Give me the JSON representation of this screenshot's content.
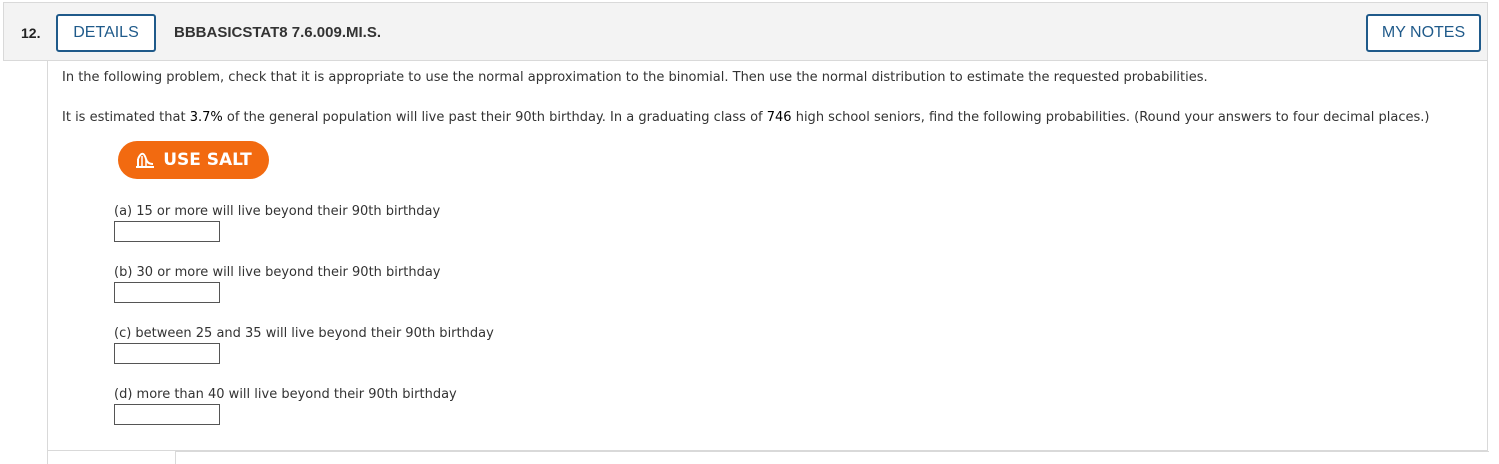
{
  "header": {
    "question_number": "12.",
    "details_label": "DETAILS",
    "question_id": "BBBASICSTAT8 7.6.009.MI.S.",
    "my_notes_label": "MY NOTES"
  },
  "problem": {
    "instruction": "In the following problem, check that it is appropriate to use the normal approximation to the binomial. Then use the normal distribution to estimate the requested probabilities.",
    "statement_part1": "It is estimated that ",
    "percent": "3.7%",
    "statement_part2": " of the general population will live past their 90th birthday. In a graduating class of ",
    "class_size": "746",
    "statement_part3": " high school seniors, find the following probabilities. (Round your answers to four decimal places.)"
  },
  "salt_button": {
    "label": "USE SALT",
    "icon": "salt-chart-icon",
    "color": "#f26a10"
  },
  "parts": [
    {
      "label": "(a) 15 or more will live beyond their 90th birthday",
      "value": ""
    },
    {
      "label": "(b) 30 or more will live beyond their 90th birthday",
      "value": ""
    },
    {
      "label": "(c) between 25 and 35 will live beyond their 90th birthday",
      "value": ""
    },
    {
      "label": "(d) more than 40 will live beyond their 90th birthday",
      "value": ""
    }
  ],
  "colors": {
    "accent": "#1f5a8a",
    "header_bg": "#f3f3f3"
  }
}
